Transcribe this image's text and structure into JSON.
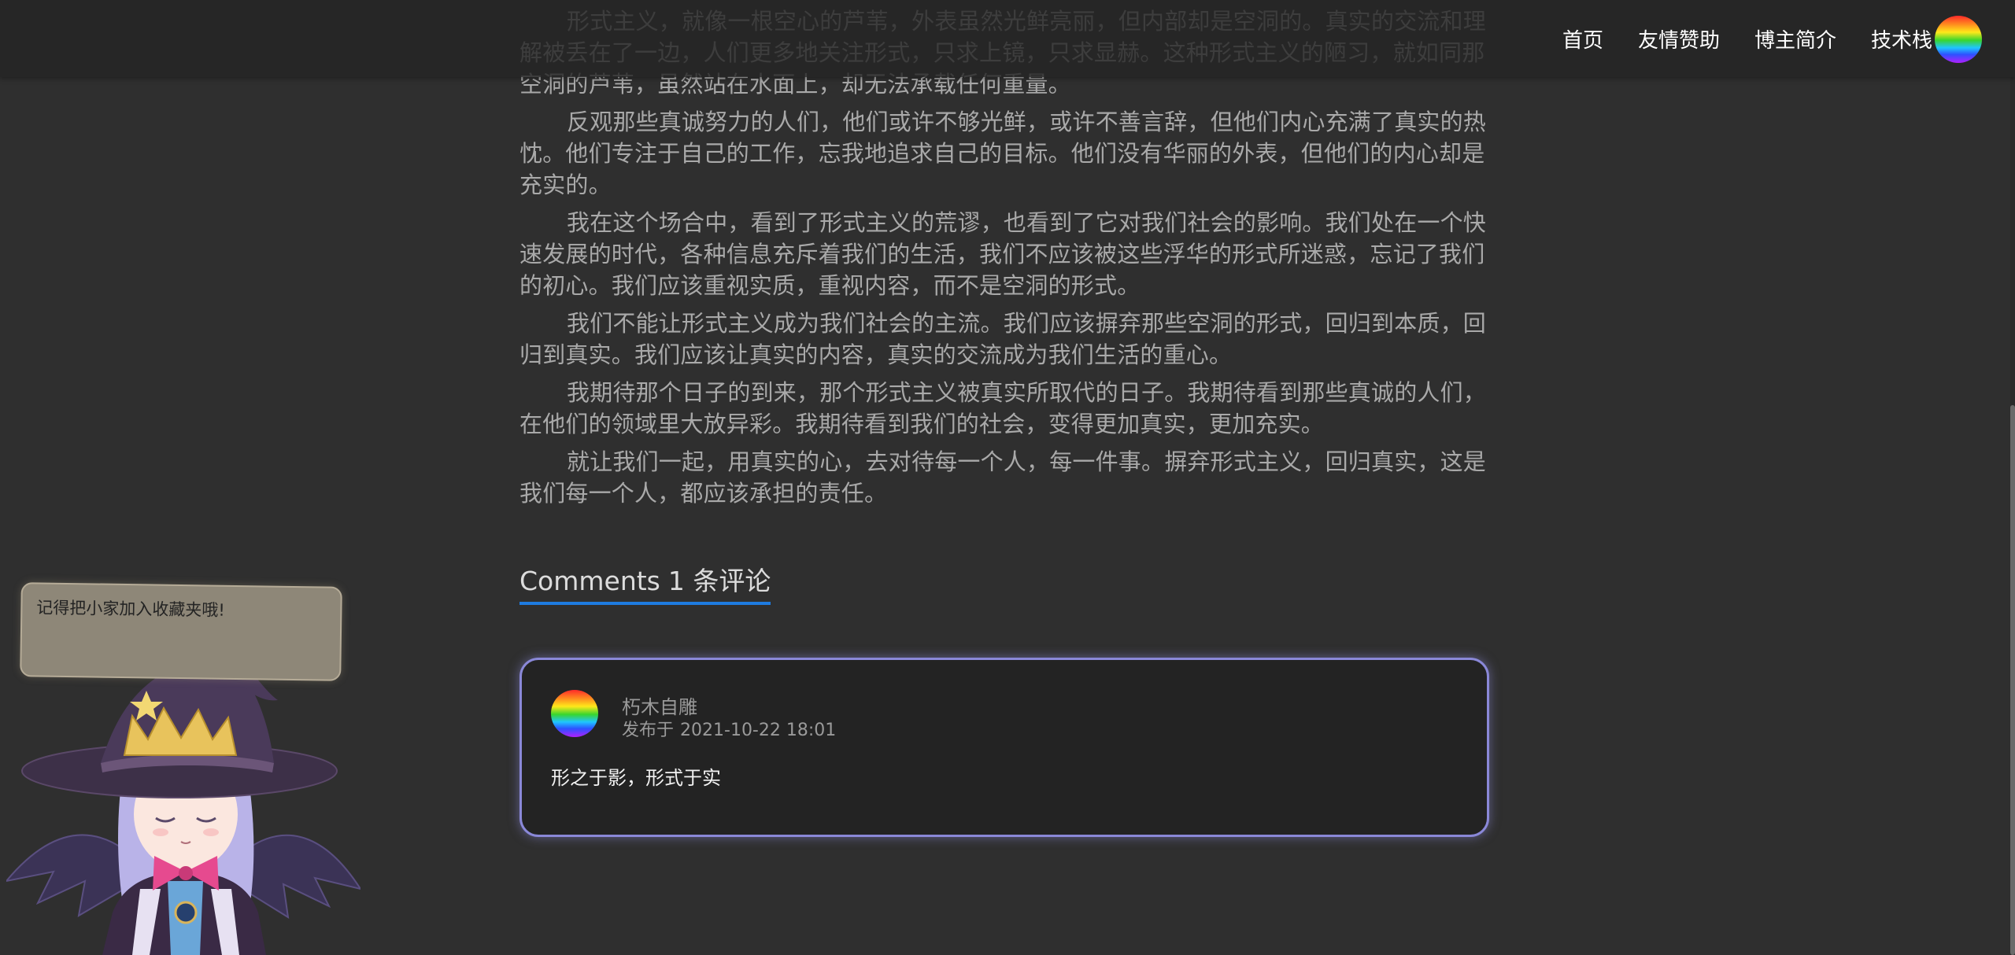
{
  "nav": {
    "items": [
      {
        "label": "首页"
      },
      {
        "label": "友情赞助"
      },
      {
        "label": "博主简介"
      },
      {
        "label": "技术栈"
      }
    ],
    "avatar_icon": "rainbow-avatar-icon"
  },
  "article": {
    "paragraphs": [
      "形式主义，就像一根空心的芦苇，外表虽然光鲜亮丽，但内部却是空洞的。真实的交流和理解被丢在了一边，人们更多地关注形式，只求上镜，只求显赫。这种形式主义的陋习，就如同那空洞的芦苇，虽然站在水面上，却无法承载任何重量。",
      "反观那些真诚努力的人们，他们或许不够光鲜，或许不善言辞，但他们内心充满了真实的热忱。他们专注于自己的工作，忘我地追求自己的目标。他们没有华丽的外表，但他们的内心却是充实的。",
      "我在这个场合中，看到了形式主义的荒谬，也看到了它对我们社会的影响。我们处在一个快速发展的时代，各种信息充斥着我们的生活，我们不应该被这些浮华的形式所迷惑，忘记了我们的初心。我们应该重视实质，重视内容，而不是空洞的形式。",
      "我们不能让形式主义成为我们社会的主流。我们应该摒弃那些空洞的形式，回归到本质，回归到真实。我们应该让真实的内容，真实的交流成为我们生活的重心。",
      "我期待那个日子的到来，那个形式主义被真实所取代的日子。我期待看到那些真诚的人们，在他们的领域里大放异彩。我期待看到我们的社会，变得更加真实，更加充实。",
      "就让我们一起，用真实的心，去对待每一个人，每一件事。摒弃形式主义，回归真实，这是我们每一个人，都应该承担的责任。"
    ]
  },
  "comments": {
    "heading_prefix": "Comments",
    "heading_count": "1 条评论",
    "items": [
      {
        "author": "朽木自雕",
        "time_prefix": "发布于",
        "time": "2021-10-22 18:01",
        "content": "形之于影，形式于实"
      }
    ]
  },
  "mascot": {
    "bubble_text": "记得把小家加入收藏夹哦!",
    "icon": "witch-mascot-icon"
  },
  "colors": {
    "background": "#2f2f2f",
    "accent_underline": "#1e7be0",
    "card_border": "#8a88d8",
    "card_background": "#232323",
    "nav_text": "#ffffff",
    "article_text": "#a9a9a9"
  }
}
